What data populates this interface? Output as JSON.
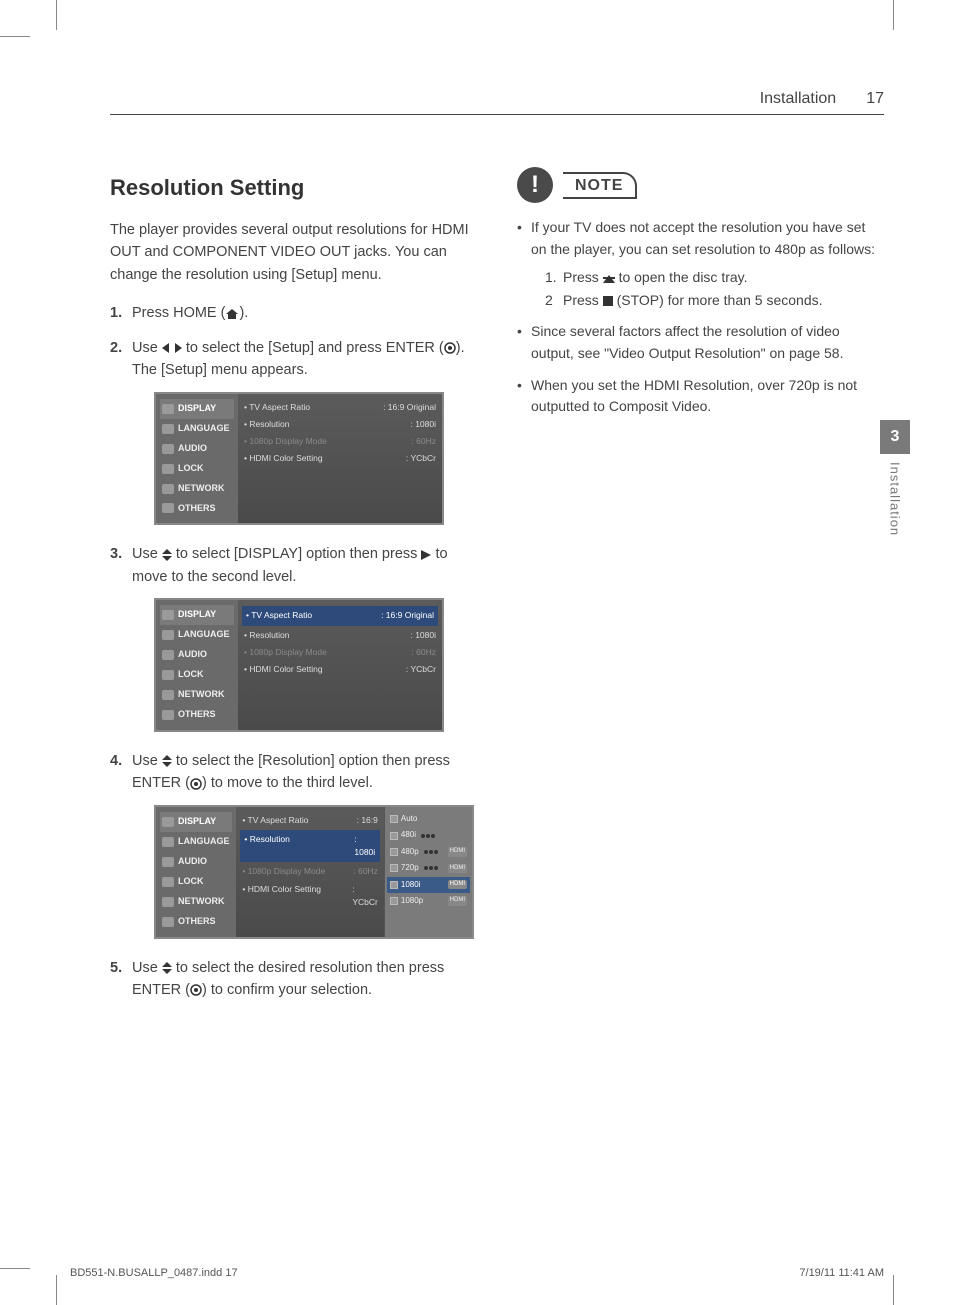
{
  "header": {
    "section": "Installation",
    "page_number": "17"
  },
  "side_tab": {
    "chapter": "3",
    "label": "Installation"
  },
  "title": "Resolution Setting",
  "intro": "The player provides several output resolutions for HDMI OUT and COMPONENT VIDEO OUT jacks. You can change the resolution using [Setup] menu.",
  "steps": [
    {
      "n": "1.",
      "text_a": "Press HOME (",
      "text_b": ")."
    },
    {
      "n": "2.",
      "text_a": "Use ",
      "text_b": " to select the [Setup] and press ENTER (",
      "text_c": "). The [Setup] menu appears."
    },
    {
      "n": "3.",
      "text_a": "Use ",
      "text_b": " to select [DISPLAY] option then press ",
      "text_c": " to move to the second level."
    },
    {
      "n": "4.",
      "text_a": "Use ",
      "text_b": " to select the [Resolution] option then press ENTER (",
      "text_c": ") to move to the third level."
    },
    {
      "n": "5.",
      "text_a": "Use ",
      "text_b": " to select the desired resolution then press ENTER (",
      "text_c": ") to confirm your selection."
    }
  ],
  "osd_menu": {
    "items": [
      "DISPLAY",
      "LANGUAGE",
      "AUDIO",
      "LOCK",
      "NETWORK",
      "OTHERS"
    ],
    "rows": [
      {
        "label": "TV Aspect Ratio",
        "value": "16:9 Original"
      },
      {
        "label": "Resolution",
        "value": "1080i"
      },
      {
        "label": "1080p Display Mode",
        "value": "60Hz",
        "dim": true
      },
      {
        "label": "HDMI Color Setting",
        "value": "YCbCr"
      }
    ]
  },
  "osd3_main": {
    "rows": [
      {
        "label": "TV Aspect Ratio",
        "value": "16:9"
      },
      {
        "label": "Resolution",
        "value": "1080i",
        "hl": true
      },
      {
        "label": "1080p Display Mode",
        "value": "60Hz",
        "dim": true
      },
      {
        "label": "HDMI Color Setting",
        "value": "YCbCr"
      }
    ]
  },
  "osd3_popup": {
    "options": [
      {
        "label": "Auto"
      },
      {
        "label": "480i",
        "dots": true
      },
      {
        "label": "480p",
        "dots": true,
        "tag": "HDMI"
      },
      {
        "label": "720p",
        "dots": true,
        "tag": "HDMI"
      },
      {
        "label": "1080i",
        "sel": true,
        "tag": "HDMI"
      },
      {
        "label": "1080p",
        "tag": "HDMI"
      }
    ]
  },
  "note": {
    "heading": "NOTE",
    "bullets": [
      {
        "text": "If your TV does not accept the resolution you have set on the player, you can set resolution to 480p as follows:",
        "sub": [
          {
            "n": "1.",
            "pre": "Press ",
            "post": " to open the disc tray."
          },
          {
            "n": "2",
            "pre": "Press ",
            "post": " (STOP) for more than 5 seconds."
          }
        ]
      },
      {
        "text": "Since several factors affect the resolution of video output, see \"Video Output Resolution\" on page 58."
      },
      {
        "text": "When you set the HDMI Resolution, over 720p is not outputted to Composit Video."
      }
    ]
  },
  "footer": {
    "left": "BD551-N.BUSALLP_0487.indd   17",
    "right": "7/19/11   11:41 AM"
  }
}
